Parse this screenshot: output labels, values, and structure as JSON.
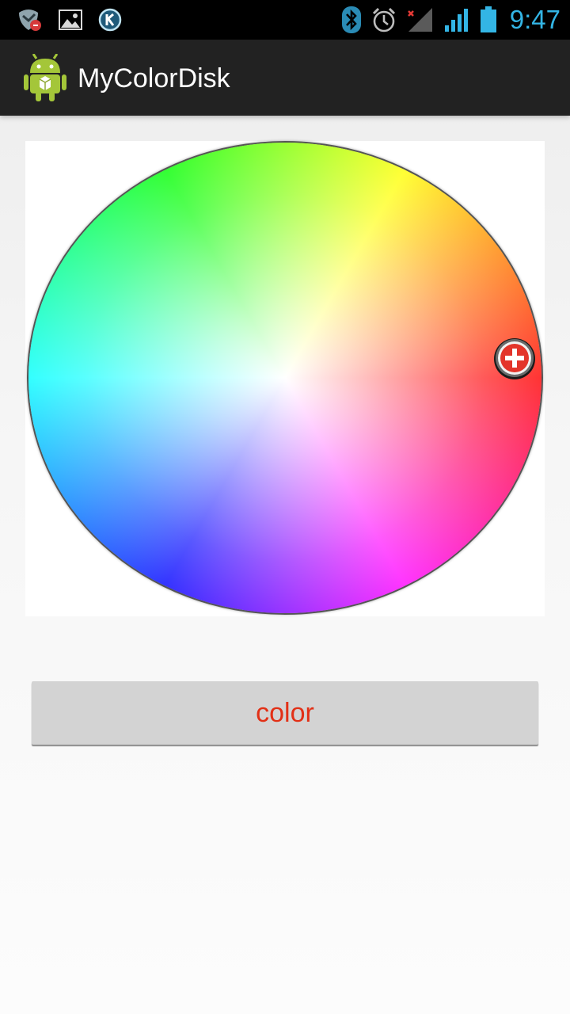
{
  "status_bar": {
    "time": "9:47",
    "left_icons": [
      "shield-alert-icon",
      "gallery-icon",
      "k-app-icon"
    ],
    "right_icons": [
      "bluetooth-icon",
      "alarm-icon",
      "signal-weak-icon",
      "signal-icon",
      "battery-icon"
    ],
    "accent_color": "#33b5e5"
  },
  "action_bar": {
    "title": "MyColorDisk",
    "icon": "android-robot-icon",
    "background": "#222222"
  },
  "color_disk": {
    "handle_icon": "plus-circle-icon",
    "selected_hue": "red"
  },
  "button": {
    "label": "color",
    "text_color": "#e23016"
  }
}
